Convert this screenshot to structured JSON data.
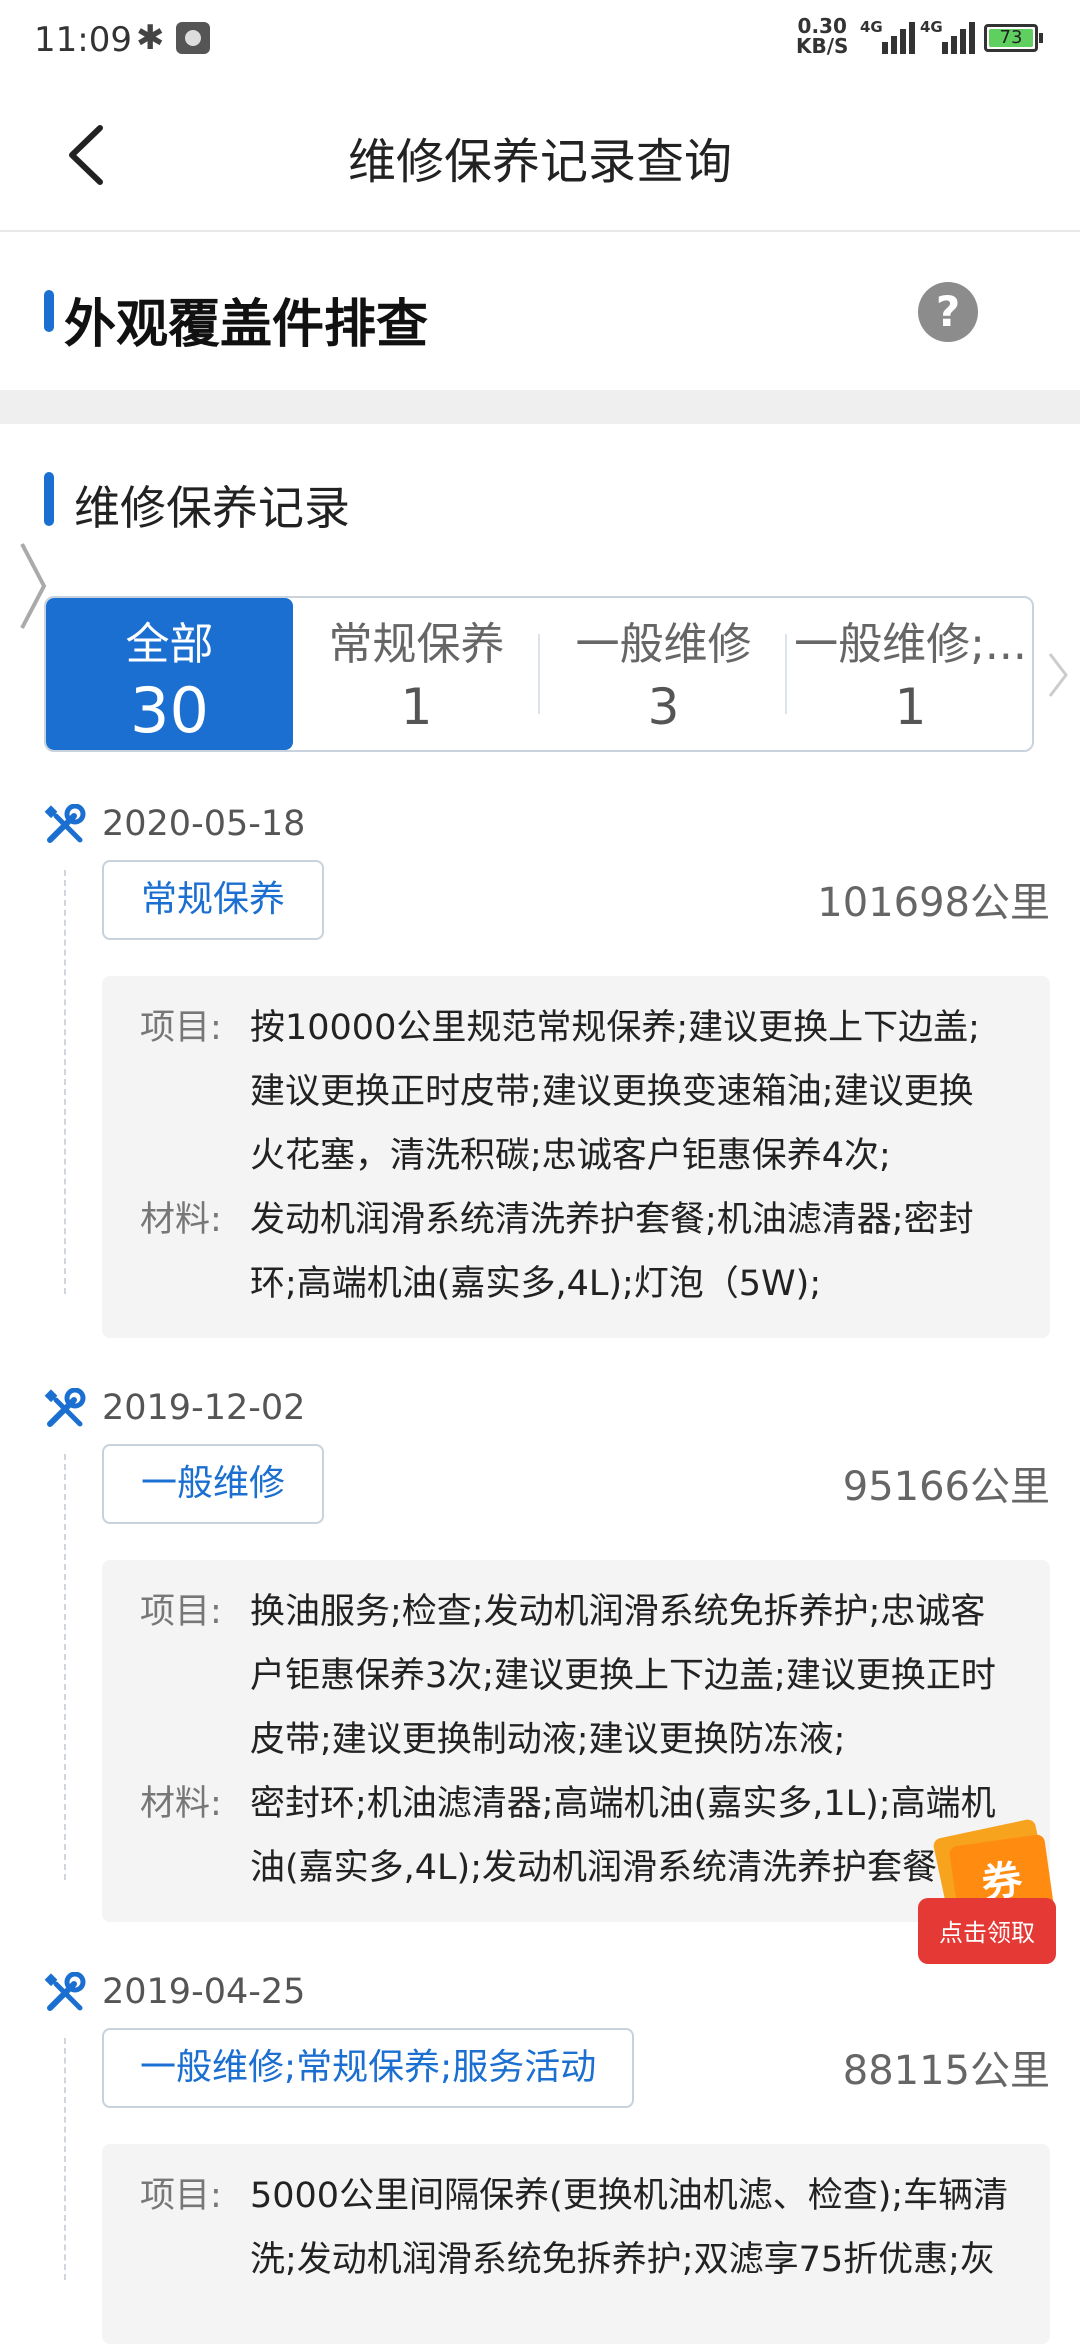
{
  "status_bar": {
    "time": "11:09",
    "speed_value": "0.30",
    "speed_unit": "KB/S",
    "network_1": "4G",
    "network_2": "4G",
    "battery": "73"
  },
  "header": {
    "title": "维修保养记录查询"
  },
  "section_exterior": {
    "title": "外观覆盖件排查",
    "help_icon": "question-circle-icon"
  },
  "section_records": {
    "title": "维修保养记录"
  },
  "tabs": [
    {
      "label": "全部",
      "count": "30",
      "active": true
    },
    {
      "label": "常规保养",
      "count": "1",
      "active": false
    },
    {
      "label": "一般维修",
      "count": "3",
      "active": false
    },
    {
      "label": "一般维修;...",
      "count": "1",
      "active": false
    }
  ],
  "labels": {
    "project": "项目:",
    "material": "材料:"
  },
  "records": [
    {
      "date": "2020-05-18",
      "type": "常规保养",
      "mileage": "101698公里",
      "project_lines": [
        "按10000公里规范常规保养;建议更换上下边盖;",
        "建议更换正时皮带;建议更换变速箱油;建议更换",
        "火花塞，清洗积碳;忠诚客户钜惠保养4次;"
      ],
      "material_lines": [
        "发动机润滑系统清洗养护套餐;机油滤清器;密封",
        "环;高端机油(嘉实多,4L);灯泡（5W);"
      ]
    },
    {
      "date": "2019-12-02",
      "type": "一般维修",
      "mileage": "95166公里",
      "project_lines": [
        "换油服务;检查;发动机润滑系统免拆养护;忠诚客",
        "户钜惠保养3次;建议更换上下边盖;建议更换正时",
        "皮带;建议更换制动液;建议更换防冻液;"
      ],
      "material_lines": [
        "密封环;机油滤清器;高端机油(嘉实多,1L);高端机",
        "油(嘉实多,4L);发动机润滑系统清洗养护套餐"
      ]
    },
    {
      "date": "2019-04-25",
      "type": "一般维修;常规保养;服务活动",
      "mileage": "88115公里",
      "project_lines": [
        "5000公里间隔保养(更换机油机滤、检查);车辆清",
        "洗;发动机润滑系统免拆养护;双滤享75折优惠;灰"
      ],
      "material_lines": []
    }
  ],
  "coupon": {
    "badge": "券",
    "label": "点击领取"
  },
  "colors": {
    "accent": "#1b6fd0",
    "coupon_red": "#e53935",
    "coupon_orange": "#ff8c10"
  }
}
